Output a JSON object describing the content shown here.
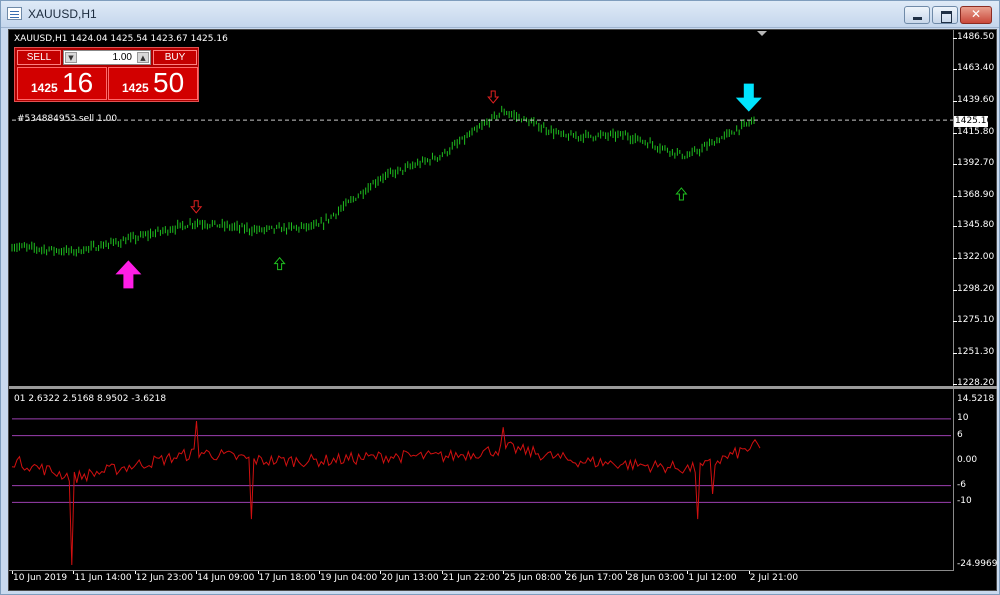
{
  "window": {
    "title": "XAUUSD,H1"
  },
  "main_pane": {
    "info": "XAUUSD,H1  1424.04 1425.54 1423.67 1425.16",
    "order_line_label": "#534884953 sell 1.00",
    "current_price": "1425.16",
    "price_labels": [
      "1486.50",
      "1463.40",
      "1439.60",
      "1415.80",
      "1392.70",
      "1368.90",
      "1345.80",
      "1322.00",
      "1298.20",
      "1275.10",
      "1251.30",
      "1228.20"
    ]
  },
  "trade_panel": {
    "sell_label": "SELL",
    "buy_label": "BUY",
    "lot_value": "1.00",
    "lot_down_icon": "▼",
    "lot_up_icon": "▲",
    "sell_price_small": "1425",
    "sell_price_big": "16",
    "buy_price_small": "1425",
    "buy_price_big": "50"
  },
  "indicator_pane": {
    "info": "01 2.6322 2.5168 8.9502 -3.6218",
    "labels": [
      "14.5218",
      "10",
      "6",
      "0.00",
      "-6",
      "-10",
      "-24.9969"
    ]
  },
  "time_labels": [
    "10 Jun 2019",
    "11 Jun 14:00",
    "12 Jun 23:00",
    "14 Jun 09:00",
    "17 Jun 18:00",
    "19 Jun 04:00",
    "20 Jun 13:00",
    "21 Jun 22:00",
    "25 Jun 08:00",
    "26 Jun 17:00",
    "28 Jun 03:00",
    "1 Jul 12:00",
    "2 Jul 21:00"
  ],
  "colors": {
    "background": "#000000",
    "candles": "#1fbf1f",
    "indicator_line": "#d01010",
    "level_lines": "#9b3fb0",
    "buy_arrow_big": "#ff1ee6",
    "sell_arrow_big": "#00e5ff",
    "signal_up_small": "#1fbf1f",
    "signal_down_small": "#e02020"
  },
  "chart_data": {
    "type": "line",
    "symbol": "XAUUSD",
    "timeframe": "H1",
    "x": [
      "10 Jun 2019",
      "11 Jun 14:00",
      "12 Jun 23:00",
      "14 Jun 09:00",
      "17 Jun 18:00",
      "19 Jun 04:00",
      "20 Jun 13:00",
      "21 Jun 22:00",
      "25 Jun 08:00",
      "26 Jun 17:00",
      "28 Jun 03:00",
      "1 Jul 12:00",
      "2 Jul 21:00"
    ],
    "series": [
      {
        "values": [
          1331,
          1327,
          1337,
          1349,
          1343,
          1346,
          1382,
          1399,
          1432,
          1413,
          1414,
          1398,
          1425
        ]
      }
    ],
    "ylim": [
      1228.2,
      1486.5
    ],
    "indicator": {
      "values": [
        0,
        -4,
        -1,
        2,
        0,
        0,
        1,
        1,
        3,
        0,
        -1,
        -2,
        4
      ],
      "levels": [
        10,
        6,
        0,
        -6,
        -10
      ],
      "ylim": [
        -24.9969,
        14.5218
      ]
    },
    "order_line": 1425.16,
    "signals": [
      {
        "type": "buy",
        "x": "11 Jun 14:00",
        "price": 1322.0
      },
      {
        "type": "sell",
        "x": "14 Jun 09:00",
        "price": 1356.0
      },
      {
        "type": "buy",
        "x": "17 Jun 18:00",
        "price": 1330.0
      },
      {
        "type": "sell",
        "x": "25 Jun 08:00",
        "price": 1438.0
      },
      {
        "type": "buy",
        "x": "1 Jul 12:00",
        "price": 1382.0
      },
      {
        "type": "sell",
        "x": "2 Jul 21:00",
        "price": 1430.0
      }
    ]
  }
}
